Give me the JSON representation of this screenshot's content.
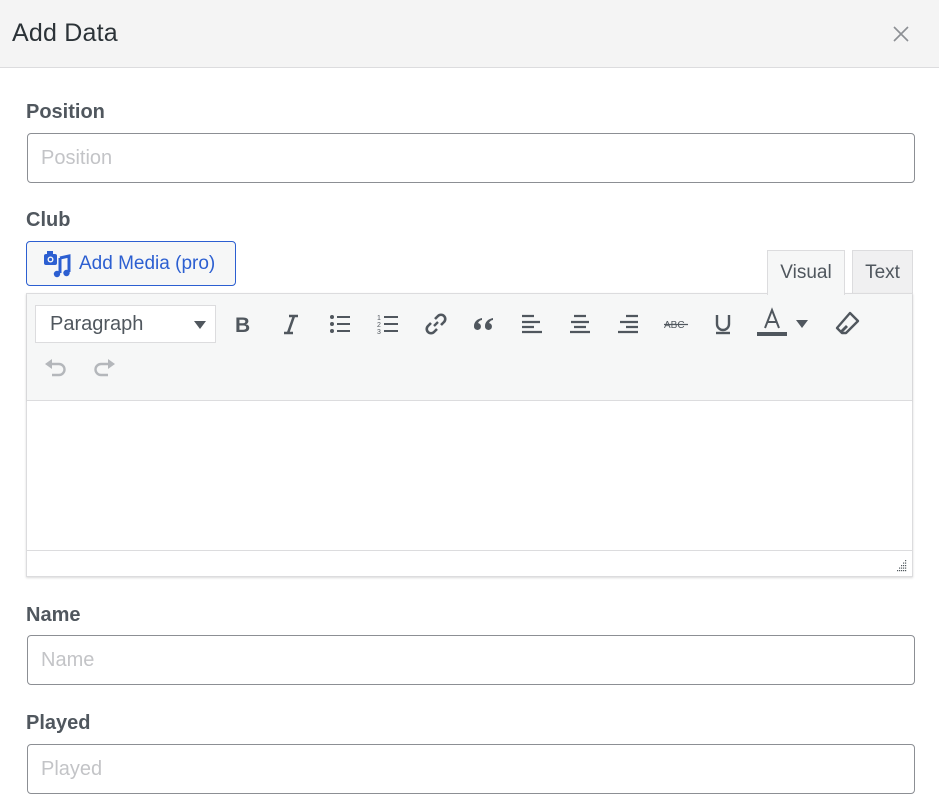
{
  "dialog": {
    "title": "Add Data",
    "close_icon": "close-icon"
  },
  "fields": {
    "position": {
      "label": "Position",
      "placeholder": "Position",
      "value": ""
    },
    "club": {
      "label": "Club"
    },
    "name": {
      "label": "Name",
      "placeholder": "Name",
      "value": ""
    },
    "played": {
      "label": "Played",
      "placeholder": "Played",
      "value": ""
    }
  },
  "editor": {
    "add_media_label": "Add Media (pro)",
    "add_media_icon": "media-camera-music-icon",
    "tabs": [
      {
        "label": "Visual",
        "active": true
      },
      {
        "label": "Text",
        "active": false
      }
    ],
    "format_select": {
      "selected": "Paragraph"
    },
    "toolbar_buttons": [
      "bold-icon",
      "italic-icon",
      "bullet-list-icon",
      "numbered-list-icon",
      "link-icon",
      "blockquote-icon",
      "align-left-icon",
      "align-center-icon",
      "align-right-icon",
      "strikethrough-icon",
      "underline-icon",
      "text-color-icon",
      "text-color-dropdown-icon",
      "clear-formatting-icon",
      "undo-icon",
      "redo-icon"
    ],
    "content": ""
  },
  "colors": {
    "accent": "#2c5fd1",
    "header_bg": "#f4f4f4",
    "toolbar_bg": "#f6f7f7",
    "icon": "#50575e"
  }
}
